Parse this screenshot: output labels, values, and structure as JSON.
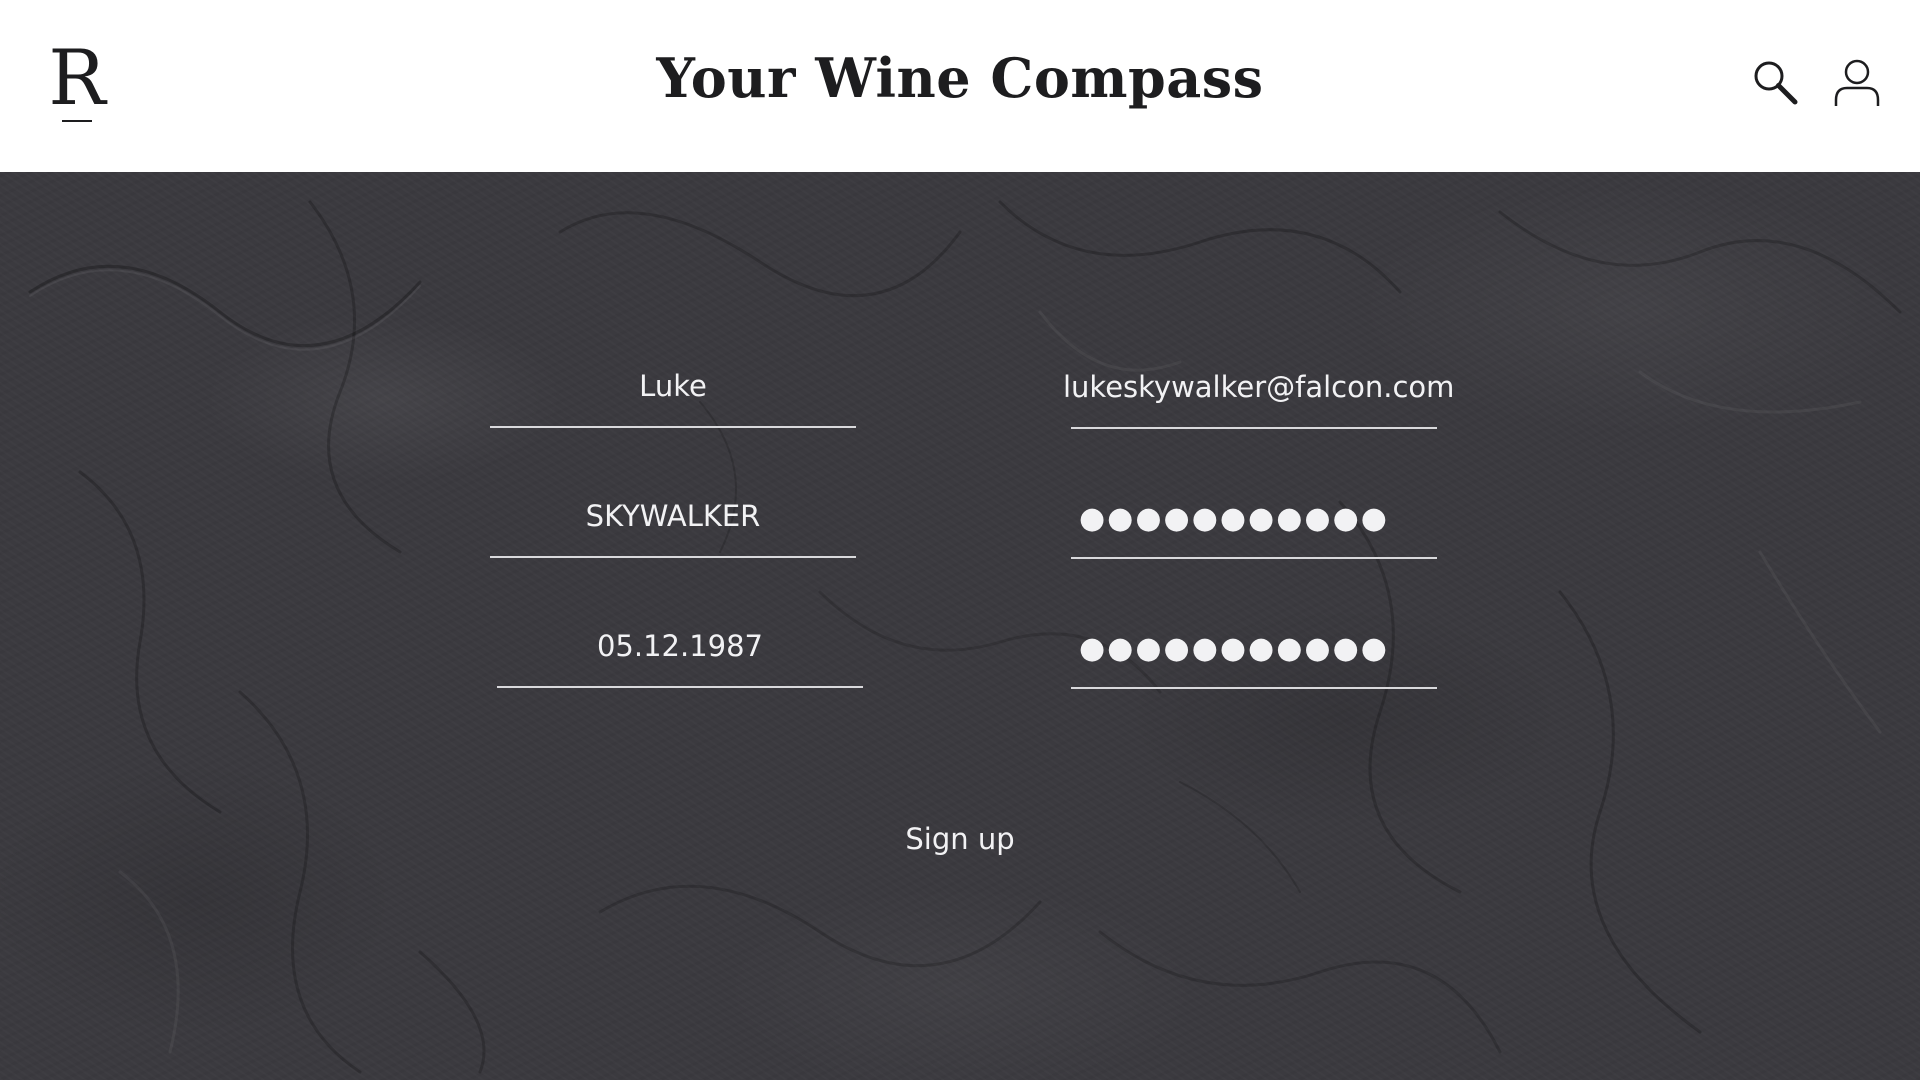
{
  "header": {
    "logo_letter": "R",
    "title": "Your Wine Compass",
    "icons": {
      "search": "search-icon",
      "account": "user-icon"
    }
  },
  "form": {
    "first_name": {
      "value": "Luke"
    },
    "last_name": {
      "value": "SKYWALKER"
    },
    "birthdate": {
      "value": "05.12.1987"
    },
    "email": {
      "value": "lukeskywalker@falcon.com"
    },
    "password": {
      "value": "●●●●●●●●●●●"
    },
    "confirm_password": {
      "value": "●●●●●●●●●●●"
    },
    "submit_label": "Sign up"
  },
  "colors": {
    "header_bg": "#ffffff",
    "title_text": "#1d1d1f",
    "panel_bg": "#3b3a3f",
    "field_text": "#f2f2f4",
    "underline": "#d9d9dc"
  }
}
